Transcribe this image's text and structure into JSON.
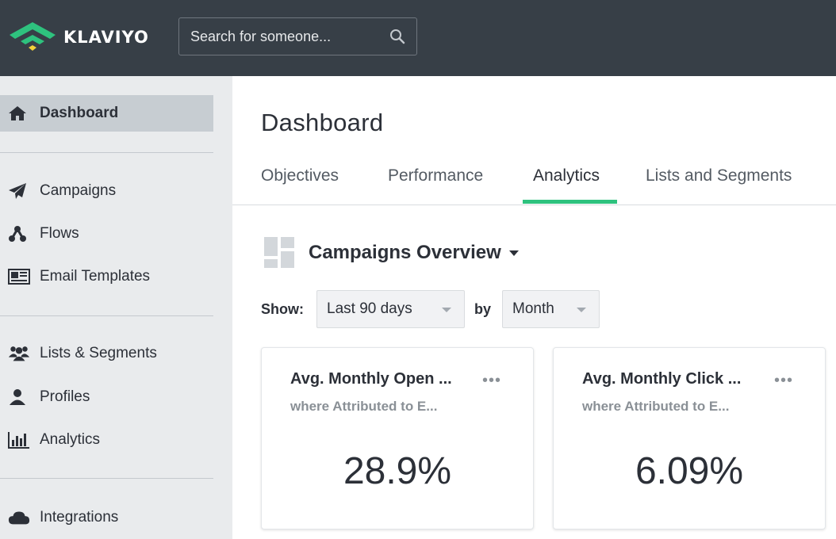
{
  "header": {
    "logo_text": "KLAVIYO",
    "search_placeholder": "Search for someone..."
  },
  "sidebar": {
    "items": [
      {
        "label": "Dashboard",
        "icon": "home-icon",
        "active": true
      },
      {
        "label": "Campaigns",
        "icon": "paper-plane-icon"
      },
      {
        "label": "Flows",
        "icon": "flows-icon"
      },
      {
        "label": "Email Templates",
        "icon": "email-template-icon"
      },
      {
        "label": "Lists & Segments",
        "icon": "users-icon"
      },
      {
        "label": "Profiles",
        "icon": "user-icon"
      },
      {
        "label": "Analytics",
        "icon": "bar-chart-icon"
      },
      {
        "label": "Integrations",
        "icon": "cloud-icon"
      }
    ]
  },
  "main": {
    "title": "Dashboard",
    "tabs": [
      {
        "label": "Objectives"
      },
      {
        "label": "Performance"
      },
      {
        "label": "Analytics",
        "active": true
      },
      {
        "label": "Lists and Segments"
      }
    ],
    "overview_title": "Campaigns Overview",
    "filters": {
      "show_label": "Show:",
      "range_value": "Last 90 days",
      "by_label": "by",
      "period_value": "Month"
    },
    "cards": [
      {
        "title": "Avg. Monthly Open ...",
        "subtitle": "where Attributed to E...",
        "value": "28.9%",
        "menu": "•••"
      },
      {
        "title": "Avg. Monthly Click ...",
        "subtitle": "where Attributed to E...",
        "value": "6.09%",
        "menu": "•••"
      }
    ]
  },
  "colors": {
    "topbar": "#373f47",
    "sidebar": "#e9ebed",
    "sidebar_active": "#c7cdd2",
    "tab_accent": "#2ec27e",
    "logo_green": "#2ec27e",
    "logo_yellow": "#f2d13a"
  }
}
